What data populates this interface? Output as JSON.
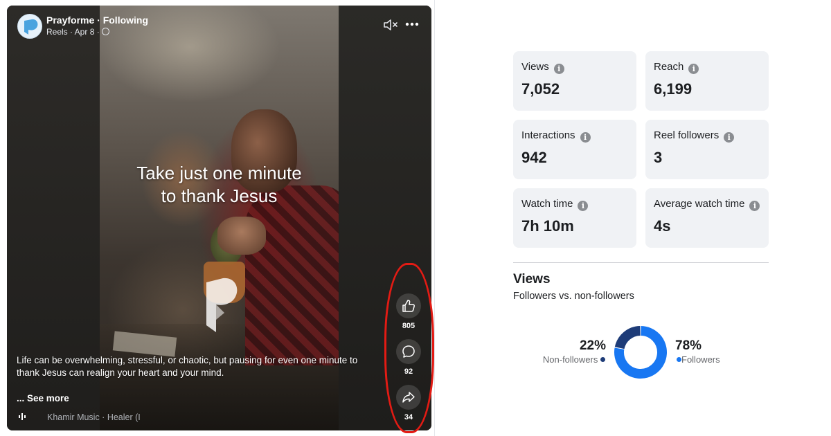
{
  "reel": {
    "author": "Prayforme · Following",
    "meta": "Reels · Apr 8 ·",
    "overlay_line1": "Take just one minute",
    "overlay_line2": "to thank Jesus",
    "caption": "Life can be overwhelming, stressful, or chaotic, but pausing for even one minute to thank Jesus can realign your heart and your mind.",
    "see_more": "... See more",
    "music": "Khamir Music · Healer (I",
    "actions": [
      {
        "icon": "thumbs-up-icon",
        "count": "805"
      },
      {
        "icon": "comment-icon",
        "count": "92"
      },
      {
        "icon": "share-icon",
        "count": "34"
      }
    ],
    "highlight_color": "#e31b14"
  },
  "metrics": [
    {
      "label": "Views",
      "value": "7,052"
    },
    {
      "label": "Reach",
      "value": "6,199"
    },
    {
      "label": "Interactions",
      "value": "942"
    },
    {
      "label": "Reel followers",
      "value": "3"
    },
    {
      "label": "Watch time",
      "value": "7h 10m"
    },
    {
      "label": "Average watch time",
      "value": "4s"
    }
  ],
  "views_section": {
    "title": "Views",
    "subtitle": "Followers vs. non-followers"
  },
  "chart_data": {
    "type": "pie",
    "categories": [
      "Non-followers",
      "Followers"
    ],
    "values": [
      22,
      78
    ],
    "labels": [
      "22%",
      "78%"
    ],
    "colors": [
      "#1e3c78",
      "#1877f2"
    ]
  }
}
